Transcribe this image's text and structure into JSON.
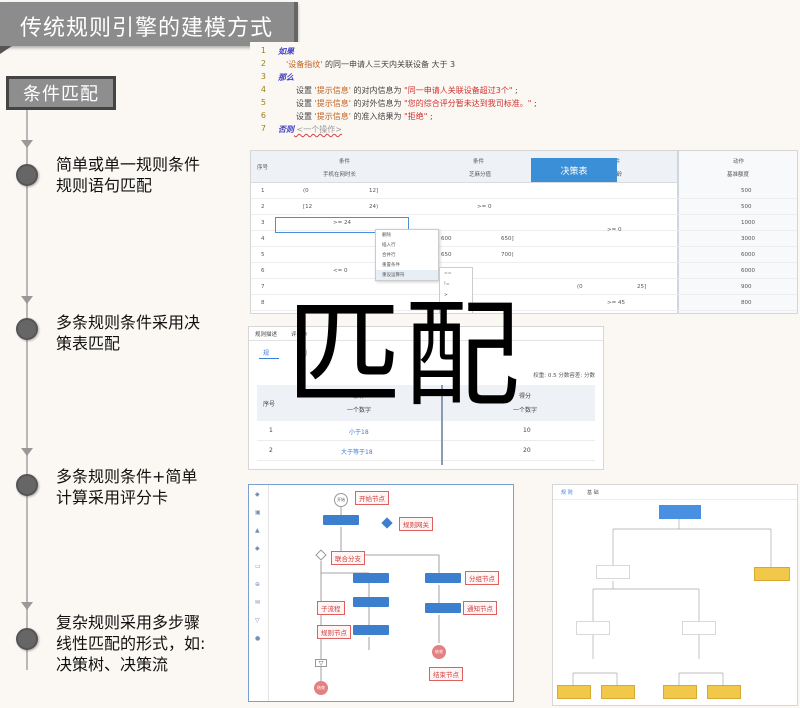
{
  "title": "传统规则引擎的建模方式",
  "match_label": "条件匹配",
  "overlay_word": "匹配",
  "steps": [
    {
      "line1": "简单或单一规则条件",
      "line2": "规则语句匹配"
    },
    {
      "line1": "多条规则条件采用决",
      "line2": "策表匹配"
    },
    {
      "line1": "多条规则条件+简单",
      "line2": "计算采用评分卡"
    },
    {
      "line1": "复杂规则采用多步骤",
      "line2": "线性匹配的形式，如:",
      "line3": "决策树、决策流"
    }
  ],
  "code": {
    "lines": [
      {
        "num": "1",
        "kw": "如果",
        "text": ""
      },
      {
        "num": "2",
        "str": "'设备指纹'",
        "text": " 的同一申请人三天内关联设备  大于  3"
      },
      {
        "num": "3",
        "kw": "那么",
        "text": ""
      },
      {
        "num": "4",
        "pre": "设置 ",
        "str": "'提示信息'",
        "text": " 的对内信息为 ",
        "red": "\"同一申请人关联设备超过3个\"",
        "post": " ;"
      },
      {
        "num": "5",
        "pre": "设置 ",
        "str": "'提示信息'",
        "text": " 的对外信息为 ",
        "red": "\"您的综合评分暂未达到我司标准。\"",
        "post": " ;"
      },
      {
        "num": "6",
        "pre": "设置 ",
        "str": "'提示信息'",
        "text": " 的准入结果为 ",
        "red": "\"拒绝\"",
        "post": " ;"
      },
      {
        "num": "7",
        "kw": "否则",
        "text": " <一个操作>"
      }
    ]
  },
  "decision_table": {
    "button": "决策表",
    "headers": {
      "seq": "序号",
      "cond": "条件",
      "action": "动作",
      "sub1": "手机在网时长",
      "sub2": "芝麻分值",
      "sub3": "年龄",
      "sub4": "基准额度"
    },
    "rows": [
      {
        "seq": "1",
        "c1": "(0",
        "c2": "12]",
        "act": "500"
      },
      {
        "seq": "2",
        "c1": "[12",
        "c2": "24)",
        "act": "500"
      },
      {
        "seq": "3",
        "c1": ">= 24",
        "c2": "",
        "act": "1000"
      },
      {
        "seq": "4",
        "c1": "",
        "c2": "",
        "act": "3000"
      },
      {
        "seq": "5",
        "c1": "",
        "c2": "",
        "act": "6000"
      },
      {
        "seq": "6",
        "c1": "",
        "c2": "",
        "act": "6000"
      },
      {
        "seq": "7",
        "c1": "",
        "c2": "",
        "act": "900"
      },
      {
        "seq": "8",
        "c1": "",
        "c2": "",
        "act": "800"
      }
    ],
    "mid": {
      "z1": ">= 0",
      "z2": ">= 0",
      "z3": "<= 0",
      "a1": "600",
      "a2": "650]",
      "a3": "650",
      "a4": "700)",
      "a5": "(0",
      "a6": "25]",
      "a7": ">= 45"
    },
    "menu": [
      "删除",
      "插入行",
      "合并行",
      "重置条件",
      "重设运算符"
    ],
    "submenu": [
      "==",
      "!=",
      ">",
      "<"
    ]
  },
  "scorecard": {
    "tabs": [
      "规则描述",
      "评分卡"
    ],
    "sub_tabs": [
      "规",
      "则"
    ],
    "meta": "权重: 0.5  分数容差: 分数",
    "headers": {
      "seq": "序号",
      "cond": "条件",
      "cond_sub": "一个数字",
      "score": "得分",
      "score_sub": "一个数字"
    },
    "rows": [
      {
        "seq": "1",
        "cond": "小于18",
        "score": "10"
      },
      {
        "seq": "2",
        "cond": "大于等于18",
        "score": "20"
      }
    ]
  },
  "flow": {
    "labels": [
      "开始节点",
      "规则网关",
      "联合分支",
      "分组节点",
      "子流程",
      "规则节点",
      "通知节点",
      "结束节点"
    ],
    "start": "开始",
    "end": "结束"
  },
  "tree": {
    "tabs": [
      "规 则",
      "基 础"
    ]
  }
}
